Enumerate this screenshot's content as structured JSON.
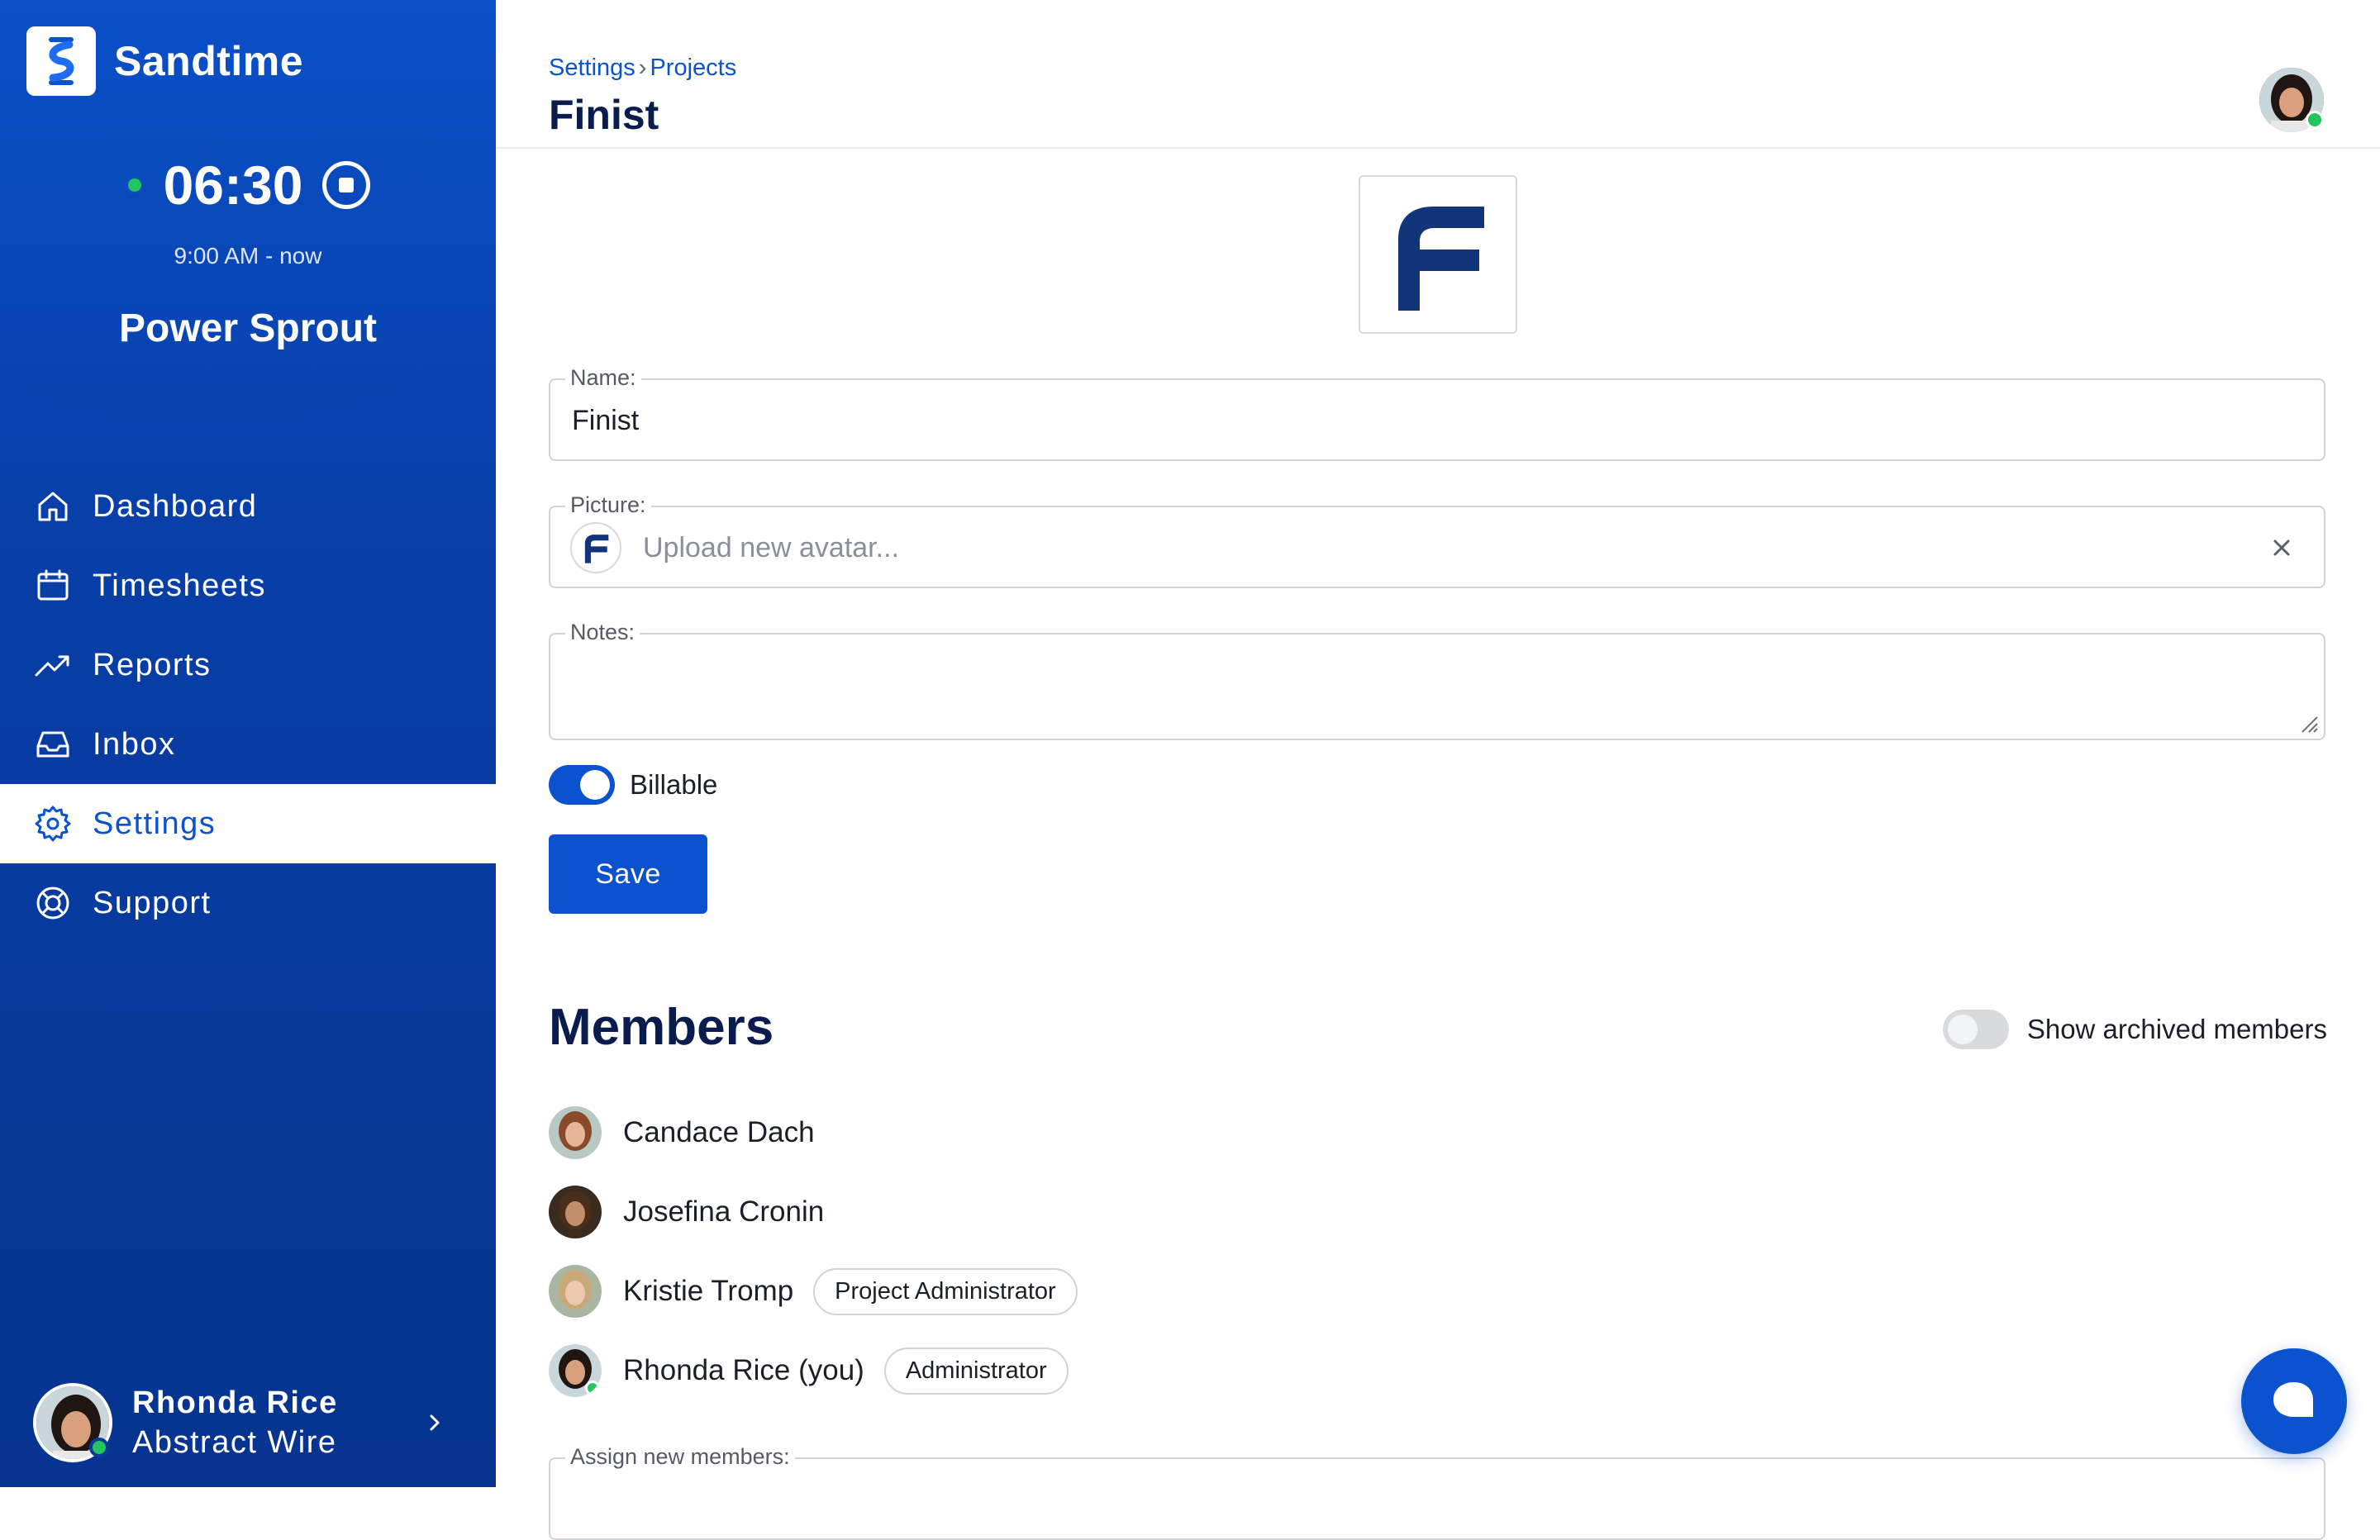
{
  "brand": {
    "name": "Sandtime"
  },
  "timer": {
    "value": "06:30",
    "range": "9:00 AM - now",
    "project": "Power Sprout"
  },
  "sidebar": {
    "items": [
      {
        "label": "Dashboard",
        "icon": "home-icon"
      },
      {
        "label": "Timesheets",
        "icon": "calendar-icon"
      },
      {
        "label": "Reports",
        "icon": "trend-icon"
      },
      {
        "label": "Inbox",
        "icon": "inbox-icon"
      },
      {
        "label": "Settings",
        "icon": "gear-icon",
        "active": true
      },
      {
        "label": "Support",
        "icon": "lifebuoy-icon"
      }
    ],
    "user": {
      "name": "Rhonda Rice",
      "company": "Abstract Wire"
    }
  },
  "header": {
    "breadcrumb": [
      "Settings",
      "Projects"
    ],
    "title": "Finist"
  },
  "form": {
    "name_label": "Name:",
    "name_value": "Finist",
    "picture_label": "Picture:",
    "picture_placeholder": "Upload new avatar...",
    "notes_label": "Notes:",
    "billable_label": "Billable",
    "billable": true,
    "save_label": "Save"
  },
  "members": {
    "title": "Members",
    "show_archived_label": "Show archived members",
    "show_archived": false,
    "list": [
      {
        "name": "Candace Dach",
        "role": ""
      },
      {
        "name": "Josefina Cronin",
        "role": ""
      },
      {
        "name": "Kristie Tromp",
        "role": "Project Administrator"
      },
      {
        "name": "Rhonda Rice (you)",
        "role": "Administrator"
      }
    ],
    "assign_label": "Assign new members:"
  },
  "colors": {
    "primary": "#0b52cf",
    "sidebar": "#083fa8",
    "online": "#22c55e"
  }
}
